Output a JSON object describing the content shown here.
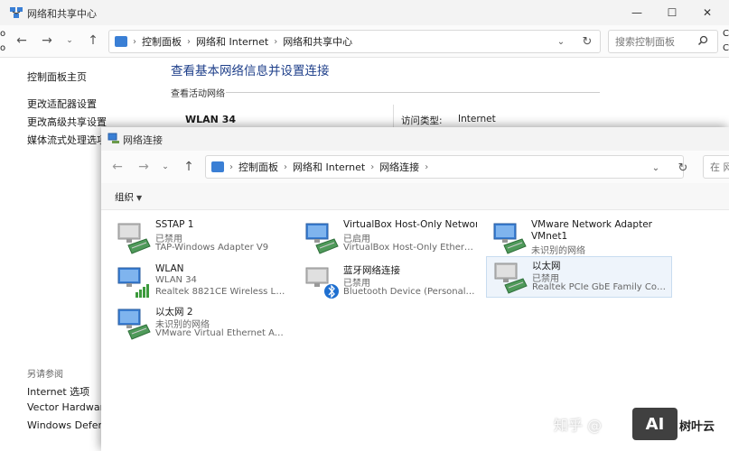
{
  "back_window": {
    "title": "网络和共享中心",
    "address": [
      "控制面板",
      "网络和 Internet",
      "网络和共享中心"
    ],
    "search_placeholder": "搜索控制面板",
    "sidebar": {
      "home": "控制面板主页",
      "links": [
        "更改适配器设置",
        "更改高级共享设置",
        "媒体流式处理选项"
      ],
      "see_also_heading": "另请参阅",
      "see_also": [
        "Internet 选项",
        "Vector Hardware",
        "Windows Defende"
      ]
    },
    "heading": "查看基本网络信息并设置连接",
    "active_networks_label": "查看活动网络",
    "network_name": "WLAN 34",
    "access_type_label": "访问类型:",
    "access_type_value": "Internet",
    "left_edge_chars": [
      "o",
      "o"
    ],
    "right_edge_chars": [
      "C",
      "C"
    ]
  },
  "front_window": {
    "title": "网络连接",
    "address": [
      "控制面板",
      "网络和 Internet",
      "网络连接"
    ],
    "search_placeholder": "在 网",
    "toolbar": {
      "organize": "组织"
    },
    "connections": [
      {
        "name": "SSTAP 1",
        "status": "已禁用",
        "device": "TAP-Windows Adapter V9",
        "icon": "network-adapter-disabled-icon"
      },
      {
        "name": "VirtualBox Host-Only Network",
        "status": "已启用",
        "device": "VirtualBox Host-Only Ethernet ...",
        "icon": "network-adapter-icon"
      },
      {
        "name": "VMware Network Adapter",
        "name2": "VMnet1",
        "status": "未识别的网络",
        "device": "",
        "icon": "network-adapter-icon"
      },
      {
        "name": "WLAN",
        "status": "WLAN 34",
        "device": "Realtek 8821CE Wireless LAN ...",
        "icon": "wifi-adapter-icon"
      },
      {
        "name": "蓝牙网络连接",
        "status": "已禁用",
        "device": "Bluetooth Device (Personal Are...",
        "icon": "bluetooth-adapter-icon"
      },
      {
        "name": "以太网",
        "status": "已禁用",
        "device": "Realtek PCIe GbE Family Contr...",
        "icon": "ethernet-adapter-disabled-icon"
      },
      {
        "name": "以太网 2",
        "status": "未识别的网络",
        "device": "VMware Virtual Ethernet Adap...",
        "icon": "network-adapter-icon"
      }
    ]
  },
  "watermark": {
    "zhihu": "知乎 @",
    "logo": "AI",
    "text": "树叶云"
  },
  "colors": {
    "heading": "#1e3f8a",
    "selection": "#eef4fb",
    "monitor": "#3a7fd5"
  }
}
